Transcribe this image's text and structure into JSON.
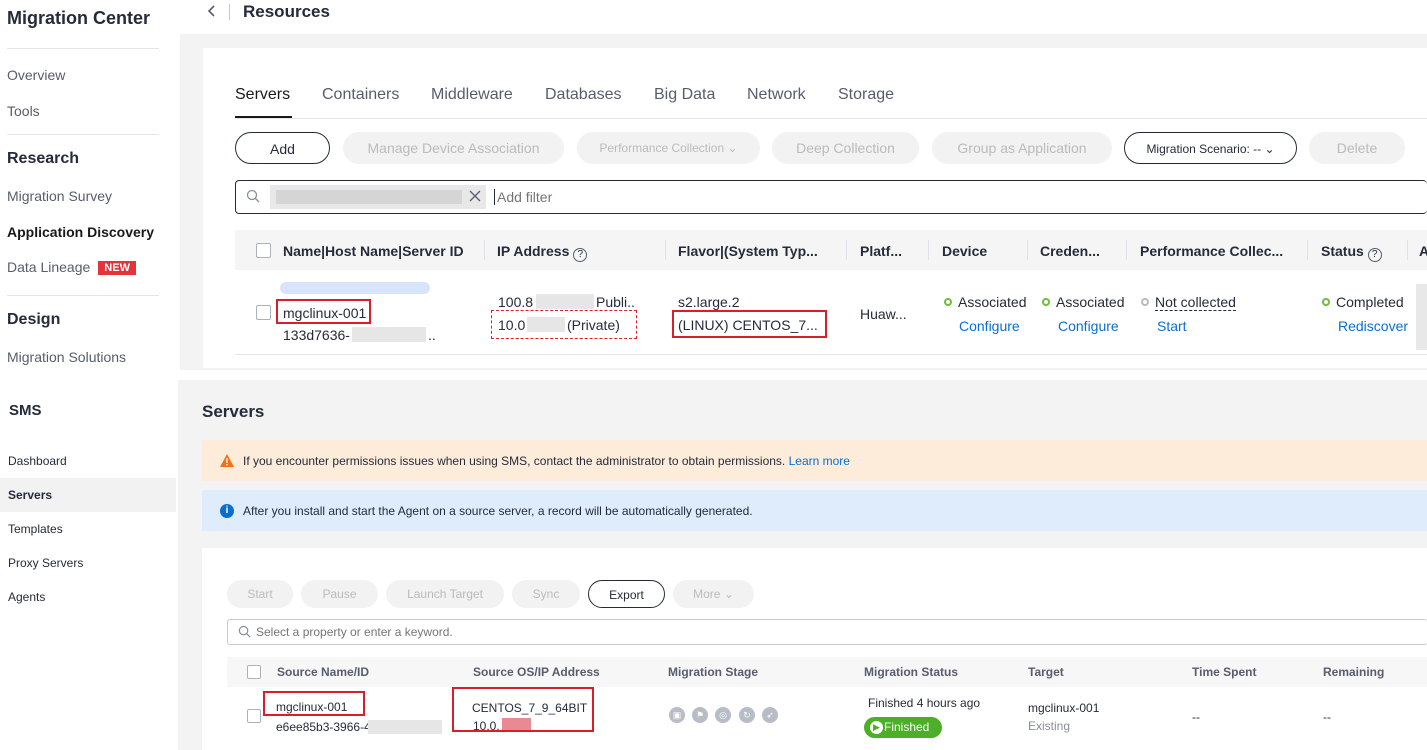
{
  "mgc_nav": {
    "title": "Migration Center",
    "overview": "Overview",
    "tools": "Tools",
    "research": "Research",
    "migration_survey": "Migration Survey",
    "application_discovery": "Application Discovery",
    "data_lineage": "Data Lineage",
    "new_badge": "NEW",
    "design": "Design",
    "migration_solutions": "Migration Solutions"
  },
  "resources": {
    "back_icon": "chevron-left-icon",
    "title": "Resources",
    "tabs": [
      "Servers",
      "Containers",
      "Middleware",
      "Databases",
      "Big Data",
      "Network",
      "Storage"
    ],
    "active_tab": "Servers",
    "buttons": {
      "add": "Add",
      "manage_device_association": "Manage Device Association",
      "performance_collection": "Performance Collection",
      "deep_collection": "Deep Collection",
      "group_as_application": "Group as Application",
      "migration_scenario": "Migration Scenario: --",
      "delete": "Delete"
    },
    "search": {
      "placeholder": "Add filter",
      "icon": "search-icon"
    },
    "columns": [
      "Name|Host Name|Server ID",
      "IP Address",
      "Flavor|(System Typ...",
      "Platf...",
      "Device",
      "Creden...",
      "Performance Collec...",
      "Status",
      "A"
    ],
    "row": {
      "name": "mgclinux-001",
      "server_id": "133d7636-",
      "server_id_suffix": "..",
      "ip_public_prefix": "100.8",
      "ip_public_suffix": "Publi..",
      "ip_private_prefix": "10.0",
      "ip_private_suffix": "(Private)",
      "flavor": "s2.large.2",
      "system_type": "(LINUX) CENTOS_7...",
      "platform": "Huaw...",
      "device_status": "Associated",
      "device_action": "Configure",
      "credential_status": "Associated",
      "credential_action": "Configure",
      "performance_status": "Not collected",
      "performance_action": "Start",
      "status": "Completed",
      "status_action": "Rediscover"
    }
  },
  "sms_nav": {
    "title": "SMS",
    "items": [
      "Dashboard",
      "Servers",
      "Templates",
      "Proxy Servers",
      "Agents"
    ],
    "active": "Servers"
  },
  "sms_servers": {
    "title": "Servers",
    "warning_text": "If you encounter permissions issues when using SMS, contact the administrator to obtain permissions.",
    "warning_link": "Learn more",
    "info_text": "After you install and start the Agent on a source server, a record will be automatically generated.",
    "buttons": [
      "Start",
      "Pause",
      "Launch Target",
      "Sync",
      "Export",
      "More"
    ],
    "search_placeholder": "Select a property or enter a keyword.",
    "columns": [
      "Source Name/ID",
      "Source OS/IP Address",
      "Migration Stage",
      "Migration Status",
      "Target",
      "Time Spent",
      "Remaining"
    ],
    "row": {
      "source_name": "mgclinux-001",
      "source_id": "e6ee85b3-3966-4",
      "os": "CENTOS_7_9_64BIT",
      "ip": "10.0.",
      "status_time": "Finished 4 hours ago",
      "status_badge": "Finished",
      "target_name": "mgclinux-001",
      "target_state": "Existing",
      "time_spent": "--",
      "remaining": "--"
    }
  },
  "colors": {
    "link": "#0a6ed1",
    "success": "#4caf27",
    "highlight": "#d81e2a",
    "warning_bg": "#fdecd9",
    "info_bg": "#deecfc"
  }
}
